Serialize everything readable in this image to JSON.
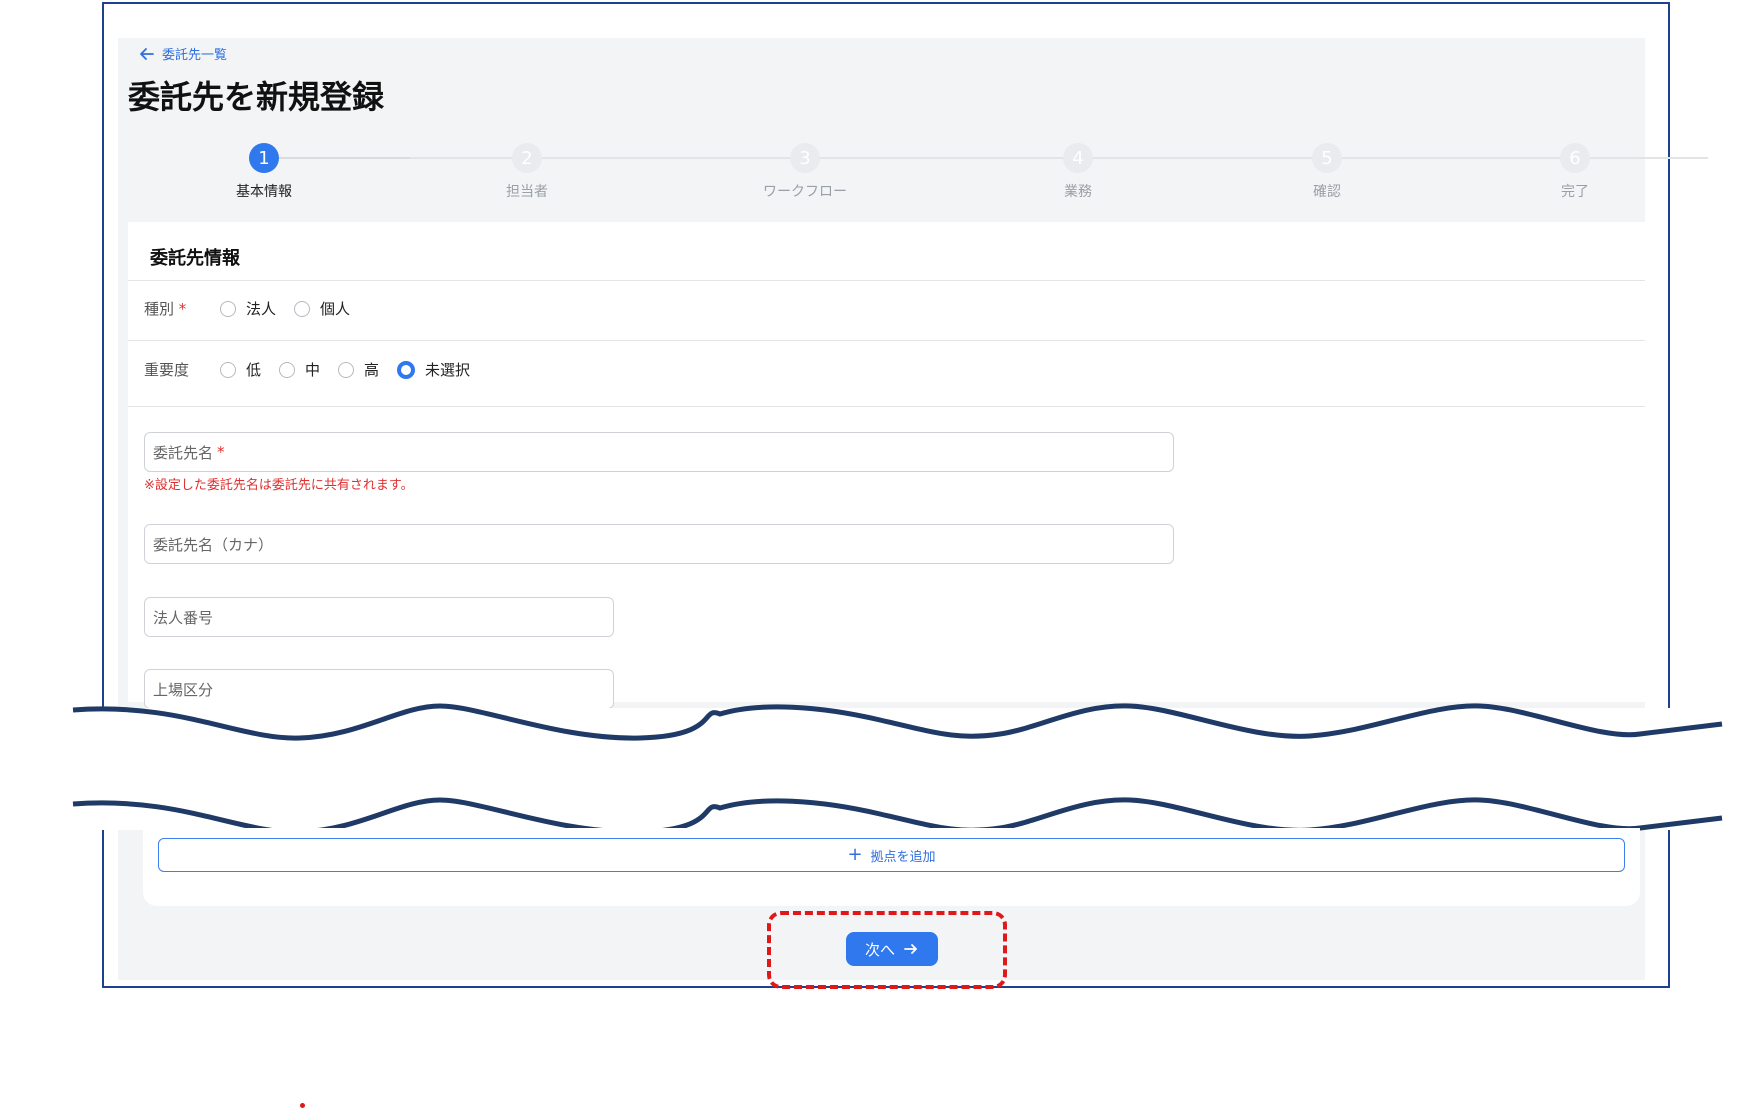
{
  "header": {
    "back_label": "委託先一覧",
    "title": "委託先を新規登録"
  },
  "stepper": {
    "current": 1,
    "steps": [
      {
        "num": "1",
        "label": "基本情報"
      },
      {
        "num": "2",
        "label": "担当者"
      },
      {
        "num": "3",
        "label": "ワークフロー"
      },
      {
        "num": "4",
        "label": "業務"
      },
      {
        "num": "5",
        "label": "確認"
      },
      {
        "num": "6",
        "label": "完了"
      }
    ]
  },
  "form": {
    "section_title": "委託先情報",
    "type": {
      "label": "種別",
      "required_mark": "*",
      "options": [
        "法人",
        "個人"
      ],
      "selected": null
    },
    "importance": {
      "label": "重要度",
      "options": [
        "低",
        "中",
        "高",
        "未選択"
      ],
      "selected": "未選択"
    },
    "name": {
      "placeholder": "委託先名",
      "required_mark": "*",
      "hint": "※設定した委託先名は委託先に共有されます。"
    },
    "name_kana": {
      "placeholder": "委託先名（カナ）"
    },
    "corporate_number": {
      "placeholder": "法人番号"
    },
    "listing": {
      "placeholder": "上場区分"
    }
  },
  "actions": {
    "add_location_label": "拠点を追加",
    "next_label": "次へ"
  },
  "colors": {
    "accent": "#2f78ee",
    "required": "#e03030",
    "highlight": "#e01818",
    "wave": "#1f3a66"
  }
}
